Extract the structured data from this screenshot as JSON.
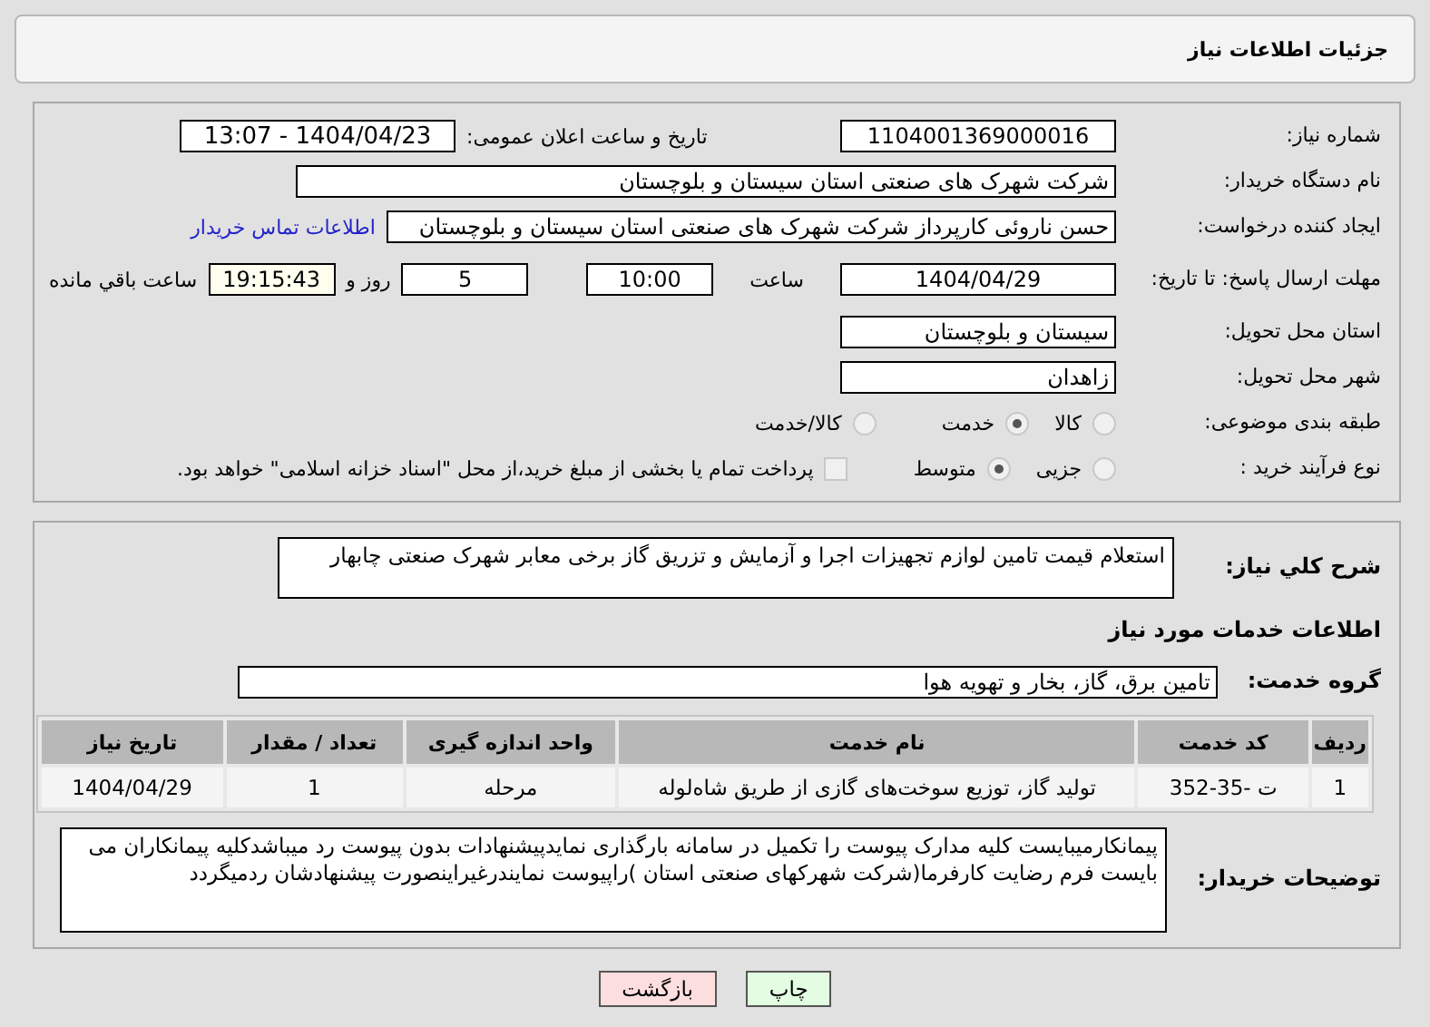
{
  "header": {
    "title": "جزئیات اطلاعات نیاز"
  },
  "need_number": {
    "label": "شماره نیاز:",
    "value": "1104001369000016"
  },
  "announce": {
    "label": "تاریخ و ساعت اعلان عمومی:",
    "value": "1404/04/23 - 13:07"
  },
  "buyer_org": {
    "label": "نام دستگاه خریدار:",
    "value": "شرکت شهرک های صنعتی استان سیستان و بلوچستان"
  },
  "requester": {
    "label": "ایجاد کننده درخواست:",
    "value": "حسن ناروئی کارپرداز شرکت شهرک های صنعتی استان سیستان و بلوچستان",
    "link": "اطلاعات تماس خریدار"
  },
  "deadline": {
    "label": "مهلت ارسال پاسخ: تا تاریخ:",
    "date": "1404/04/29",
    "time_label": "ساعت",
    "time": "10:00",
    "days": "5",
    "days_label": "روز و",
    "remaining": "19:15:43",
    "remaining_label": "ساعت باقي مانده"
  },
  "province": {
    "label": "استان محل تحویل:",
    "value": "سیستان و بلوچستان"
  },
  "city": {
    "label": "شهر محل تحویل:",
    "value": "زاهدان"
  },
  "category": {
    "label": "طبقه بندی موضوعی:",
    "options": [
      {
        "label": "کالا",
        "selected": false
      },
      {
        "label": "خدمت",
        "selected": true
      },
      {
        "label": "کالا/خدمت",
        "selected": false
      }
    ]
  },
  "process": {
    "label": "نوع فرآیند خرید :",
    "options": [
      {
        "label": "جزیی",
        "selected": false
      },
      {
        "label": "متوسط",
        "selected": true
      }
    ],
    "payment": {
      "label": "پرداخت تمام یا بخشی از مبلغ خرید،از محل \"اسناد خزانه اسلامی\" خواهد بود.",
      "checked": false
    }
  },
  "description": {
    "label": "شرح کلي نیاز:",
    "value": "استعلام قیمت تامین لوازم تجهیزات اجرا و آزمایش و تزریق گاز برخی معابر شهرک صنعتی چابهار"
  },
  "services_heading": "اطلاعات خدمات مورد نیاز",
  "service_group": {
    "label": "گروه خدمت:",
    "value": "تامین برق، گاز، بخار و تهویه هوا"
  },
  "table": {
    "columns": [
      "ردیف",
      "کد خدمت",
      "نام خدمت",
      "واحد اندازه گیری",
      "تعداد / مقدار",
      "تاریخ نیاز"
    ],
    "rows": [
      [
        "1",
        "ت -35-352",
        "تولید گاز، توزیع سوخت‌های گازی از طریق شاه‌لوله",
        "مرحله",
        "1",
        "1404/04/29"
      ]
    ]
  },
  "buyer_notes": {
    "label": "توضیحات خریدار:",
    "value": "پیمانکارمیبایست کلیه مدارک پیوست را تکمیل در سامانه بارگذاری نمایدپیشنهادات بدون پیوست رد میباشدکلیه پیمانکاران می بایست فرم رضایت کارفرما(شرکت شهرکهای صنعتی استان )راپیوست نمایندرغیراینصورت پیشنهادشان ردمیگردد"
  },
  "buttons": [
    {
      "label": "چاپ",
      "kind": "print"
    },
    {
      "label": "بازگشت",
      "kind": "back"
    }
  ]
}
